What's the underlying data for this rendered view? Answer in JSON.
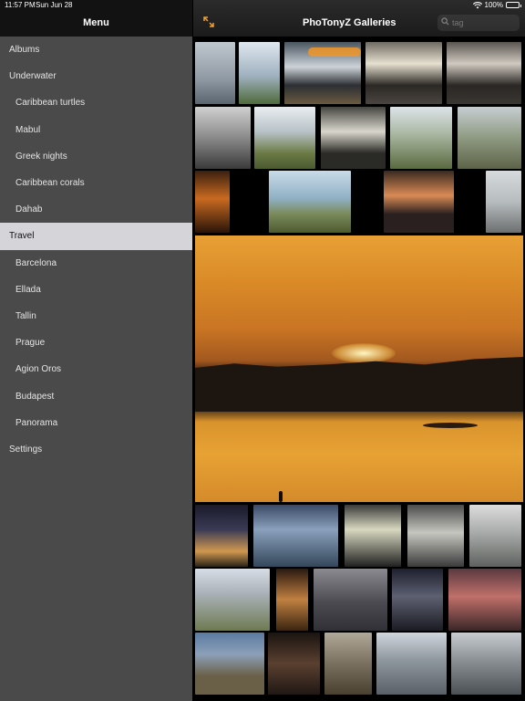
{
  "status_bar": {
    "time": "11:57 PM",
    "date": "Sun Jun 28",
    "battery": "100%"
  },
  "sidebar": {
    "title": "Menu",
    "items": [
      {
        "label": "Albums",
        "level": "top"
      },
      {
        "label": "Underwater",
        "level": "top"
      },
      {
        "label": "Caribbean turtles",
        "level": "sub"
      },
      {
        "label": "Mabul",
        "level": "sub"
      },
      {
        "label": "Greek nights",
        "level": "sub"
      },
      {
        "label": "Caribbean corals",
        "level": "sub"
      },
      {
        "label": "Dahab",
        "level": "sub"
      },
      {
        "label": "Travel",
        "level": "top",
        "selected": true
      },
      {
        "label": "Barcelona",
        "level": "sub"
      },
      {
        "label": "Ellada",
        "level": "sub"
      },
      {
        "label": "Tallin",
        "level": "sub"
      },
      {
        "label": "Prague",
        "level": "sub"
      },
      {
        "label": "Agion Oros",
        "level": "sub"
      },
      {
        "label": "Budapest",
        "level": "sub"
      },
      {
        "label": "Panorama",
        "level": "sub"
      },
      {
        "label": "Settings",
        "level": "top"
      }
    ]
  },
  "navbar": {
    "title": "PhoTonyZ Galleries",
    "search_placeholder": "tag",
    "expand_icon": "expand-arrows-icon",
    "search_icon": "search-icon"
  },
  "colors": {
    "accent": "#f0a030",
    "sidebar_bg": "#4a4a4a",
    "selected_bg": "#d4d4d9"
  }
}
